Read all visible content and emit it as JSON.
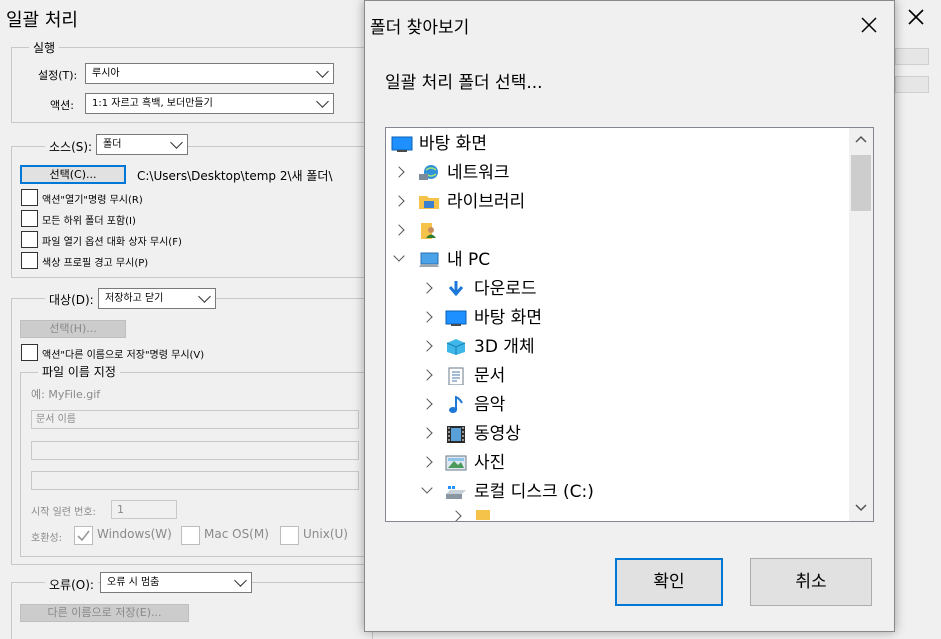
{
  "window": {
    "title": "일괄 처리"
  },
  "run_section": {
    "legend": "실행",
    "set_label": "설정(T):",
    "set_value": "루시아",
    "action_label": "액션:",
    "action_value": "1:1 자르고 흑백, 보더만들기"
  },
  "source_section": {
    "label": "소스(S):",
    "value": "폴더",
    "choose_button": "선택(C)...",
    "path": "C:\\Users\\Desktop\\temp 2\\새 폴더\\",
    "checkboxes": [
      "액션\"열기\"명령 무시(R)",
      "모든 하위 폴더 포함(I)",
      "파일 열기 옵션 대화 상자 무시(F)",
      "색상 프로필 경고 무시(P)"
    ]
  },
  "target_section": {
    "label": "대상(D):",
    "value": "저장하고 닫기",
    "choose_button": "선택(H)...",
    "override_save": "액션\"다른 이름으로 저장\"명령 무시(V)",
    "naming_legend": "파일 이름 지정",
    "example": "예: MyFile.gif",
    "naming_field1": "문서 이름",
    "serial_label": "시작 일련 번호:",
    "serial_value": "1",
    "compat_label": "호환성:",
    "compat_windows": "Windows(W)",
    "compat_mac": "Mac OS(M)",
    "compat_unix": "Unix(U)"
  },
  "error_section": {
    "label": "오류(O):",
    "value": "오류 시 멈춤",
    "save_as_button": "다른 이름으로 저장(E)..."
  },
  "dialog": {
    "title": "폴더 찾아보기",
    "prompt": "일괄 처리 폴더 선택...",
    "ok": "확인",
    "cancel": "취소",
    "tree": [
      {
        "label": "바탕 화면",
        "icon": "desktop-icon"
      },
      {
        "label": "네트워크",
        "icon": "network-icon"
      },
      {
        "label": "라이브러리",
        "icon": "library-icon"
      },
      {
        "label": "",
        "icon": "user-folder-icon"
      },
      {
        "label": "내 PC",
        "icon": "pc-icon"
      },
      {
        "label": "다운로드",
        "icon": "download-icon"
      },
      {
        "label": "바탕 화면",
        "icon": "desktop-icon"
      },
      {
        "label": "3D 개체",
        "icon": "3d-objects-icon"
      },
      {
        "label": "문서",
        "icon": "document-icon"
      },
      {
        "label": "음악",
        "icon": "music-icon"
      },
      {
        "label": "동영상",
        "icon": "video-icon"
      },
      {
        "label": "사진",
        "icon": "picture-icon"
      },
      {
        "label": "로컬 디스크 (C:)",
        "icon": "drive-icon"
      }
    ]
  },
  "colors": {
    "accent": "#0078d7",
    "dialog_bg": "#f0f0f0"
  }
}
